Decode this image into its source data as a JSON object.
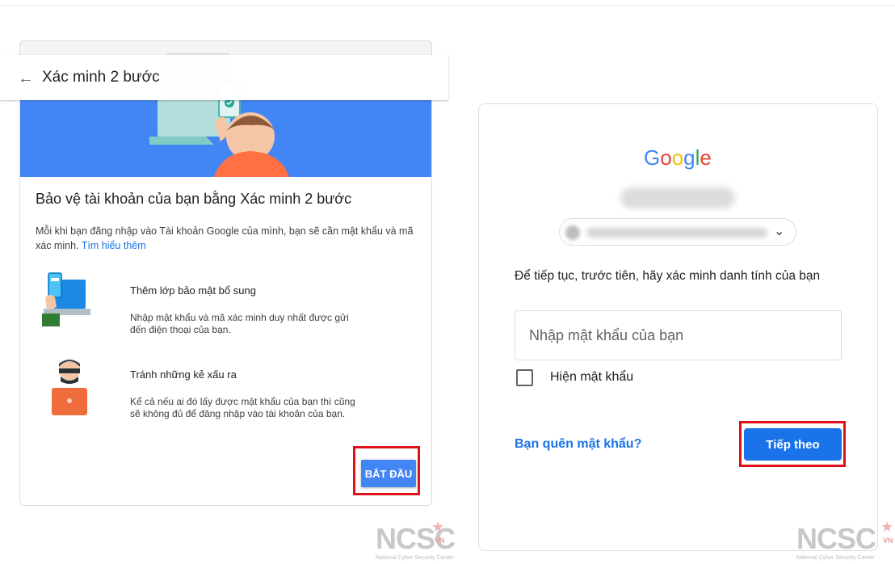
{
  "left": {
    "title": "Xác minh 2 bước",
    "heading": "Bảo vệ tài khoản của bạn bằng Xác minh 2 bước",
    "description": "Mỗi khi bạn đăng nhập vào Tài khoản Google của mình, bạn sẽ cần mật khẩu và mã xác minh.",
    "learn_more": "Tìm hiểu thêm",
    "features": [
      {
        "title": "Thêm lớp bảo mật bổ sung",
        "desc": "Nhập mật khẩu và mã xác minh duy nhất được gửi đến điện thoại của bạn."
      },
      {
        "title": "Tránh những kẻ xấu ra",
        "desc": "Kể cả nếu ai đó lấy được mật khẩu của bạn thì cũng sẽ không đủ để đăng nhập vào tài khoản của bạn."
      }
    ],
    "start_button": "BẮT ĐẦU",
    "icons": [
      "back-arrow-icon",
      "phone-laptop-illustration",
      "hacker-illustration"
    ]
  },
  "right": {
    "logo": {
      "letters": [
        "G",
        "o",
        "o",
        "g",
        "l",
        "e"
      ],
      "colors": [
        "#4285F4",
        "#EA4335",
        "#FBBC05",
        "#4285F4",
        "#34A853",
        "#EA4335"
      ]
    },
    "verify_text": "Để tiếp tục, trước tiên, hãy xác minh danh tính của bạn",
    "password_placeholder": "Nhập mật khẩu của bạn",
    "show_password": "Hiện mật khẩu",
    "forgot_password": "Bạn quên mật khẩu?",
    "next_button": "Tiếp theo",
    "icons": [
      "chevron-down-icon",
      "checkbox-icon"
    ]
  },
  "watermark": {
    "brand": "NCSC",
    "country": "VN",
    "subtitle": "National Cyber Security Center"
  },
  "colors": {
    "google_blue": "#1a73e8",
    "hero_blue": "#4285f4",
    "highlight_red": "#e0101a"
  }
}
